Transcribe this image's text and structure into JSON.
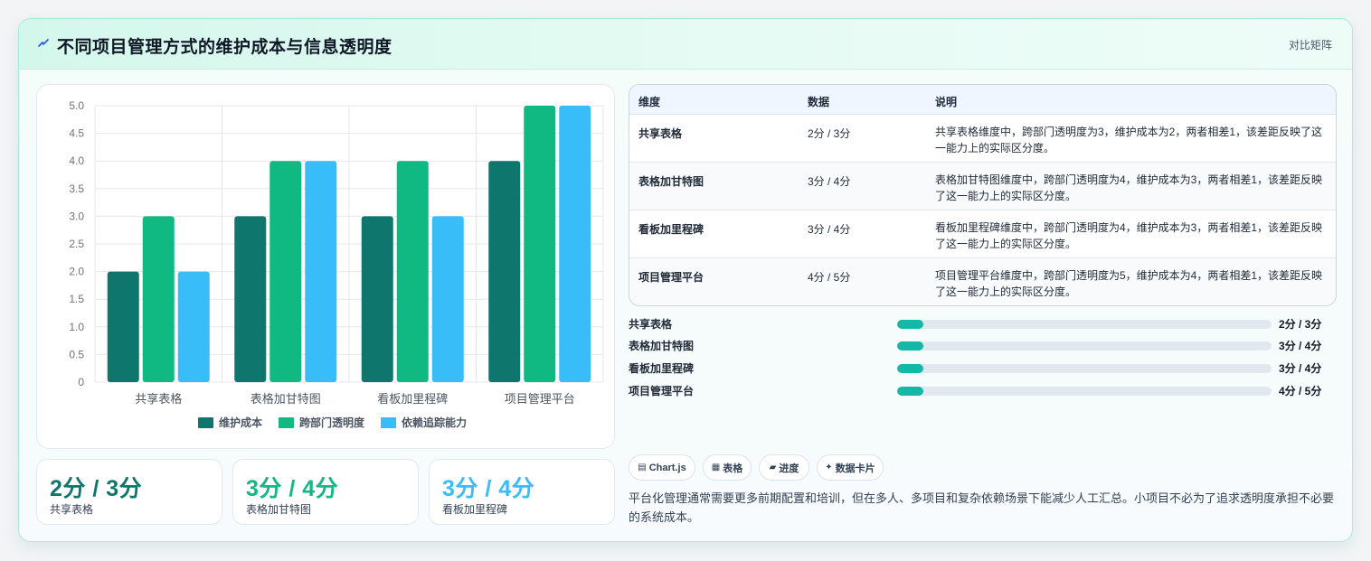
{
  "header": {
    "title": "不同项目管理方式的维护成本与信息透明度",
    "tag": "对比矩阵",
    "icon": "lightning-icon"
  },
  "colors": {
    "maintenance": "#0f766e",
    "transparency": "#10b981",
    "tracking": "#38bdf8",
    "progress": "#14b8a6"
  },
  "chart_data": {
    "type": "bar",
    "categories": [
      "共享表格",
      "表格加甘特图",
      "看板加里程碑",
      "项目管理平台"
    ],
    "series": [
      {
        "name": "维护成本",
        "values": [
          2,
          3,
          3,
          4
        ],
        "color": "#0f766e"
      },
      {
        "name": "跨部门透明度",
        "values": [
          3,
          4,
          4,
          5
        ],
        "color": "#10b981"
      },
      {
        "name": "依赖追踪能力",
        "values": [
          2,
          4,
          3,
          5
        ],
        "color": "#38bdf8"
      }
    ],
    "yticks": [
      "0",
      "0.5",
      "1.0",
      "1.5",
      "2.0",
      "2.5",
      "3.0",
      "3.5",
      "4.0",
      "4.5",
      "5.0"
    ],
    "ylim": [
      0,
      5
    ],
    "grid": true,
    "legend": "bottom"
  },
  "kpis": [
    {
      "value": "2分 / 3分",
      "label": "共享表格",
      "color": "#0f766e"
    },
    {
      "value": "3分 / 4分",
      "label": "表格加甘特图",
      "color": "#10b981"
    },
    {
      "value": "3分 / 4分",
      "label": "看板加里程碑",
      "color": "#38bdf8"
    }
  ],
  "table": {
    "headers": [
      "维度",
      "数据",
      "说明"
    ],
    "rows": [
      {
        "dim": "共享表格",
        "val": "2分 / 3分",
        "desc": "共享表格维度中，跨部门透明度为3，维护成本为2，两者相差1，该差距反映了这一能力上的实际区分度。"
      },
      {
        "dim": "表格加甘特图",
        "val": "3分 / 4分",
        "desc": "表格加甘特图维度中，跨部门透明度为4，维护成本为3，两者相差1，该差距反映了这一能力上的实际区分度。"
      },
      {
        "dim": "看板加里程碑",
        "val": "3分 / 4分",
        "desc": "看板加里程碑维度中，跨部门透明度为4，维护成本为3，两者相差1，该差距反映了这一能力上的实际区分度。"
      },
      {
        "dim": "项目管理平台",
        "val": "4分 / 5分",
        "desc": "项目管理平台维度中，跨部门透明度为5，维护成本为4，两者相差1，该差距反映了这一能力上的实际区分度。"
      }
    ]
  },
  "progress": [
    {
      "label": "共享表格",
      "value": "2分 / 3分",
      "fraction": 0.07
    },
    {
      "label": "表格加甘特图",
      "value": "3分 / 4分",
      "fraction": 0.07
    },
    {
      "label": "看板加里程碑",
      "value": "3分 / 4分",
      "fraction": 0.07
    },
    {
      "label": "项目管理平台",
      "value": "4分 / 5分",
      "fraction": 0.07
    }
  ],
  "pills": [
    {
      "icon": "▤",
      "icon_name": "chart-icon",
      "label": "Chart.js"
    },
    {
      "icon": "▦",
      "icon_name": "table-icon",
      "label": "表格"
    },
    {
      "icon": "▰",
      "icon_name": "progress-icon",
      "label": "进度"
    },
    {
      "icon": "✦",
      "icon_name": "sparkle-icon",
      "label": "数据卡片"
    }
  ],
  "footnote": "平台化管理通常需要更多前期配置和培训，但在多人、多项目和复杂依赖场景下能减少人工汇总。小项目不必为了追求透明度承担不必要的系统成本。"
}
